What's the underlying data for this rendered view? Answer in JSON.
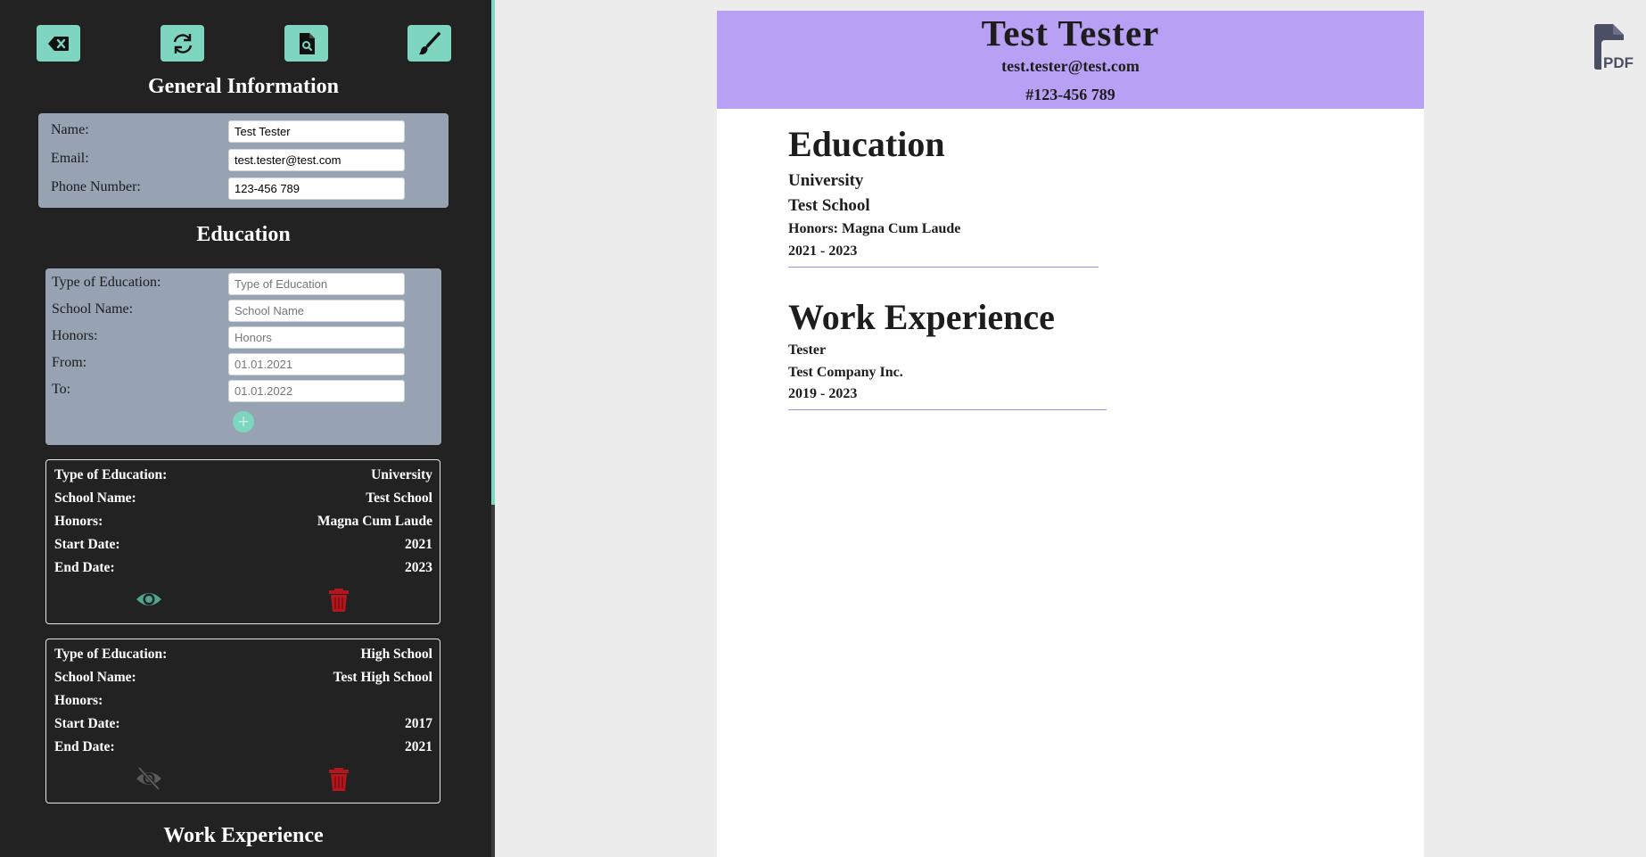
{
  "colors": {
    "accent": "#7fd6c0",
    "sidebar_bg": "#222222",
    "panel_bg": "#97a3b3",
    "resume_header_bg": "#b8a1f5",
    "delete_red": "#b3161c",
    "eye_green": "#4ea48d"
  },
  "toolbar": {
    "icons": [
      "backspace-icon",
      "refresh-icon",
      "file-search-icon",
      "brush-icon"
    ]
  },
  "general": {
    "title": "General Information",
    "name_label": "Name:",
    "name_value": "Test Tester",
    "email_label": "Email:",
    "email_value": "test.tester@test.com",
    "phone_label": "Phone Number:",
    "phone_value": "123-456 789"
  },
  "education": {
    "title": "Education",
    "form": {
      "type_label": "Type of Education:",
      "type_placeholder": "Type of Education",
      "school_label": "School Name:",
      "school_placeholder": "School Name",
      "honors_label": "Honors:",
      "honors_placeholder": "Honors",
      "from_label": "From:",
      "from_placeholder": "01.01.2021",
      "to_label": "To:",
      "to_placeholder": "01.01.2022",
      "add_label": "+"
    },
    "entries": [
      {
        "type_label": "Type of Education:",
        "type": "University",
        "school_label": "School Name:",
        "school": "Test School",
        "honors_label": "Honors:",
        "honors": "Magna Cum Laude",
        "start_label": "Start Date:",
        "start": "2021",
        "end_label": "End Date:",
        "end": "2023",
        "visible": true
      },
      {
        "type_label": "Type of Education:",
        "type": "High School",
        "school_label": "School Name:",
        "school": "Test High School",
        "honors_label": "Honors:",
        "honors": "",
        "start_label": "Start Date:",
        "start": "2017",
        "end_label": "End Date:",
        "end": "2021",
        "visible": false
      }
    ]
  },
  "work": {
    "title": "Work Experience"
  },
  "resume": {
    "name": "Test Tester",
    "email": "test.tester@test.com",
    "phone": "#123-456 789",
    "education_heading": "Education",
    "education": {
      "type": "University",
      "school": "Test School",
      "honors": "Honors: Magna Cum Laude",
      "dates": "2021 - 2023"
    },
    "work_heading": "Work Experience",
    "work": {
      "position": "Tester",
      "company": "Test Company Inc.",
      "dates": "2019 - 2023"
    }
  },
  "pdf_button": {
    "label": "PDF"
  }
}
